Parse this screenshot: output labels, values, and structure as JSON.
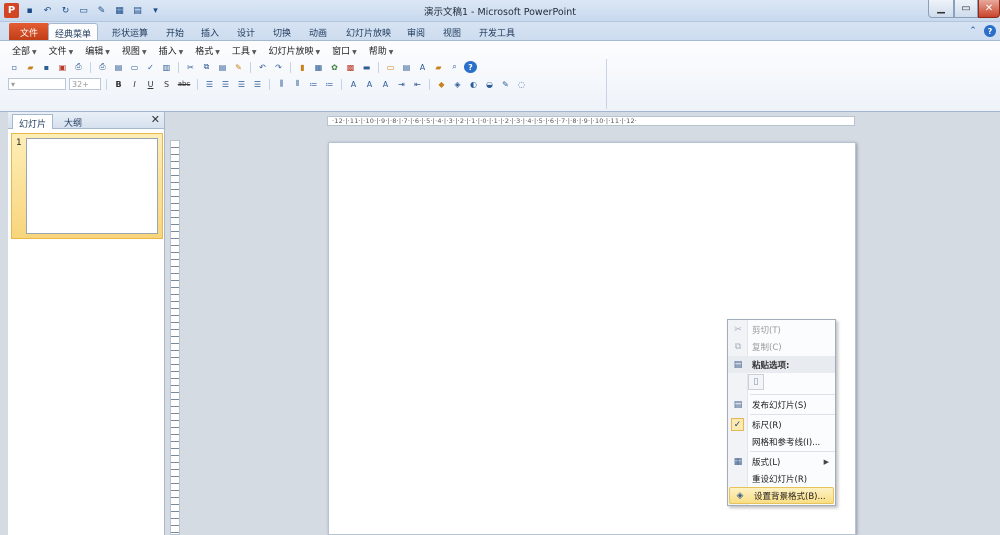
{
  "window": {
    "title": "演示文稿1  -  Microsoft PowerPoint",
    "app_icon": "P",
    "qat_icons": [
      "save-icon",
      "undo-icon",
      "redo-icon",
      "new-slide-icon",
      "customize-icon"
    ],
    "controls": {
      "minimize": "▁",
      "maximize": "▭",
      "close": "✕"
    }
  },
  "tabs": [
    {
      "label": "文件"
    },
    {
      "label": "经典菜单"
    },
    {
      "label": "形状运算"
    },
    {
      "label": "开始"
    },
    {
      "label": "插入"
    },
    {
      "label": "设计"
    },
    {
      "label": "切换"
    },
    {
      "label": "动画"
    },
    {
      "label": "幻灯片放映"
    },
    {
      "label": "审阅"
    },
    {
      "label": "视图"
    },
    {
      "label": "开发工具"
    }
  ],
  "ribbon": {
    "menus": [
      {
        "label": "全部"
      },
      {
        "label": "文件"
      },
      {
        "label": "编辑"
      },
      {
        "label": "视图"
      },
      {
        "label": "插入"
      },
      {
        "label": "格式"
      },
      {
        "label": "工具"
      },
      {
        "label": "幻灯片放映"
      },
      {
        "label": "窗口"
      },
      {
        "label": "帮助"
      }
    ],
    "font_size_box": "32+",
    "format_buttons": {
      "bold": "B",
      "italic": "I",
      "underline": "U",
      "shadow": "S",
      "strike": "abc"
    }
  },
  "panel": {
    "tabs": [
      {
        "label": "幻灯片"
      },
      {
        "label": "大纲"
      }
    ],
    "close": "✕",
    "slide_number": "1"
  },
  "ruler": {
    "h_text": "·12·|·11·|·10·|·9·|·8·|·7·|·6·|·5·|·4·|·3·|·2·|·1·|·0·|·1·|·2·|·3·|·4·|·5·|·6·|·7·|·8·|·9·|·10·|·11·|·12·"
  },
  "context_menu": {
    "cut": "剪切(T)",
    "copy": "复制(C)",
    "paste_header": "粘贴选项:",
    "publish": "发布幻灯片(S)",
    "ruler": "标尺(R)",
    "grid": "网格和参考线(I)...",
    "layout": "版式(L)",
    "reset": "重设幻灯片(R)",
    "background": "设置背景格式(B)..."
  }
}
